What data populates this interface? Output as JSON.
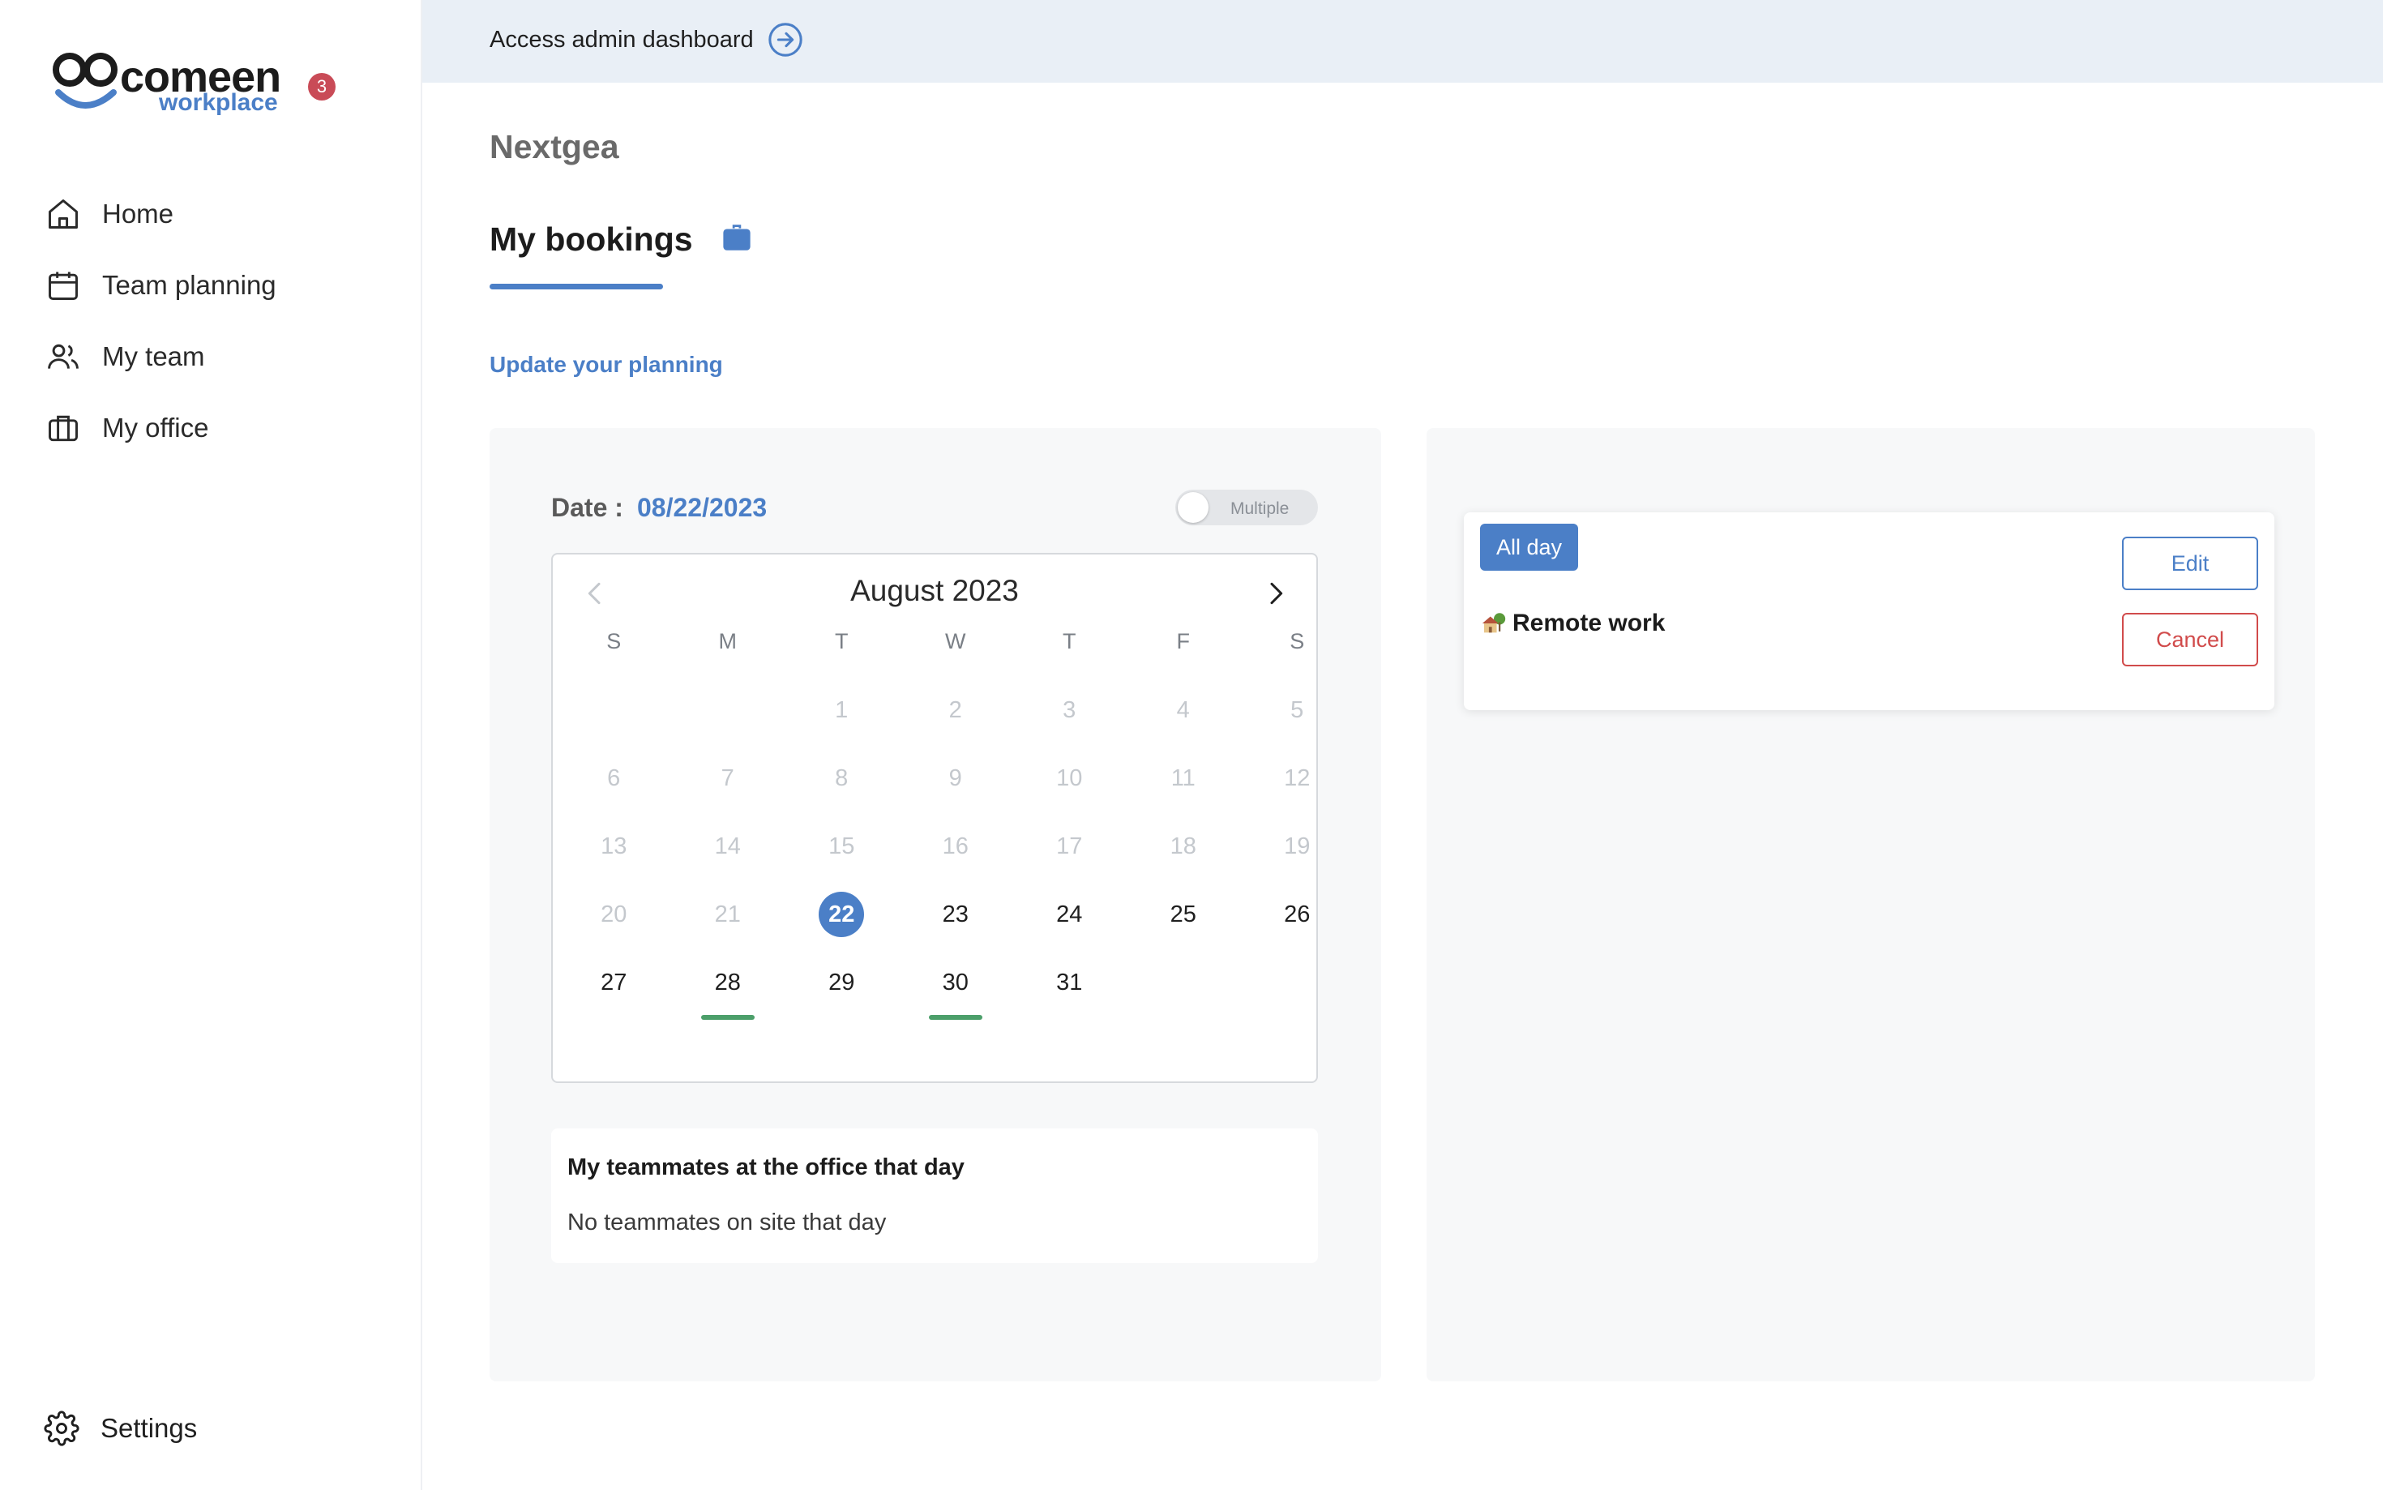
{
  "brand": {
    "name": "comeen",
    "sub": "workplace",
    "notification_count": "3",
    "accent": "#4b7fc7"
  },
  "sidebar": {
    "items": [
      {
        "label": "Home",
        "icon": "home-icon"
      },
      {
        "label": "Team planning",
        "icon": "calendar-icon"
      },
      {
        "label": "My team",
        "icon": "users-icon"
      },
      {
        "label": "My office",
        "icon": "briefcase-icon"
      }
    ],
    "settings_label": "Settings"
  },
  "banner": {
    "link_label": "Access admin dashboard",
    "icon": "arrow-right-circle-icon"
  },
  "main": {
    "company": "Nextgea",
    "title": "My bookings",
    "title_icon": "briefcase-icon",
    "update_link": "Update your planning"
  },
  "date_panel": {
    "label": "Date :",
    "value": "08/22/2023",
    "toggle_label": "Multiple",
    "toggle_on": false
  },
  "calendar": {
    "month_label": "August 2023",
    "weekdays": [
      "S",
      "M",
      "T",
      "W",
      "T",
      "F",
      "S"
    ],
    "weeks": [
      [
        null,
        null,
        "1",
        "2",
        "3",
        "4",
        "5"
      ],
      [
        "6",
        "7",
        "8",
        "9",
        "10",
        "11",
        "12"
      ],
      [
        "13",
        "14",
        "15",
        "16",
        "17",
        "18",
        "19"
      ],
      [
        "20",
        "21",
        "22",
        "23",
        "24",
        "25",
        "26"
      ],
      [
        "27",
        "28",
        "29",
        "30",
        "31",
        null,
        null
      ]
    ],
    "past_days": [
      "1",
      "2",
      "3",
      "4",
      "5",
      "6",
      "7",
      "8",
      "9",
      "10",
      "11",
      "12",
      "13",
      "14",
      "15",
      "16",
      "17",
      "18",
      "19",
      "20",
      "21"
    ],
    "selected_day": "22",
    "booked_days": [
      "28",
      "30"
    ],
    "booked_color": "#4c9f6a"
  },
  "teammates": {
    "title": "My teammates at the office that day",
    "empty_text": "No teammates on site that day"
  },
  "booking": {
    "period": "All day",
    "type": "Remote work",
    "type_icon": "house-tree-icon",
    "edit_label": "Edit",
    "cancel_label": "Cancel"
  }
}
